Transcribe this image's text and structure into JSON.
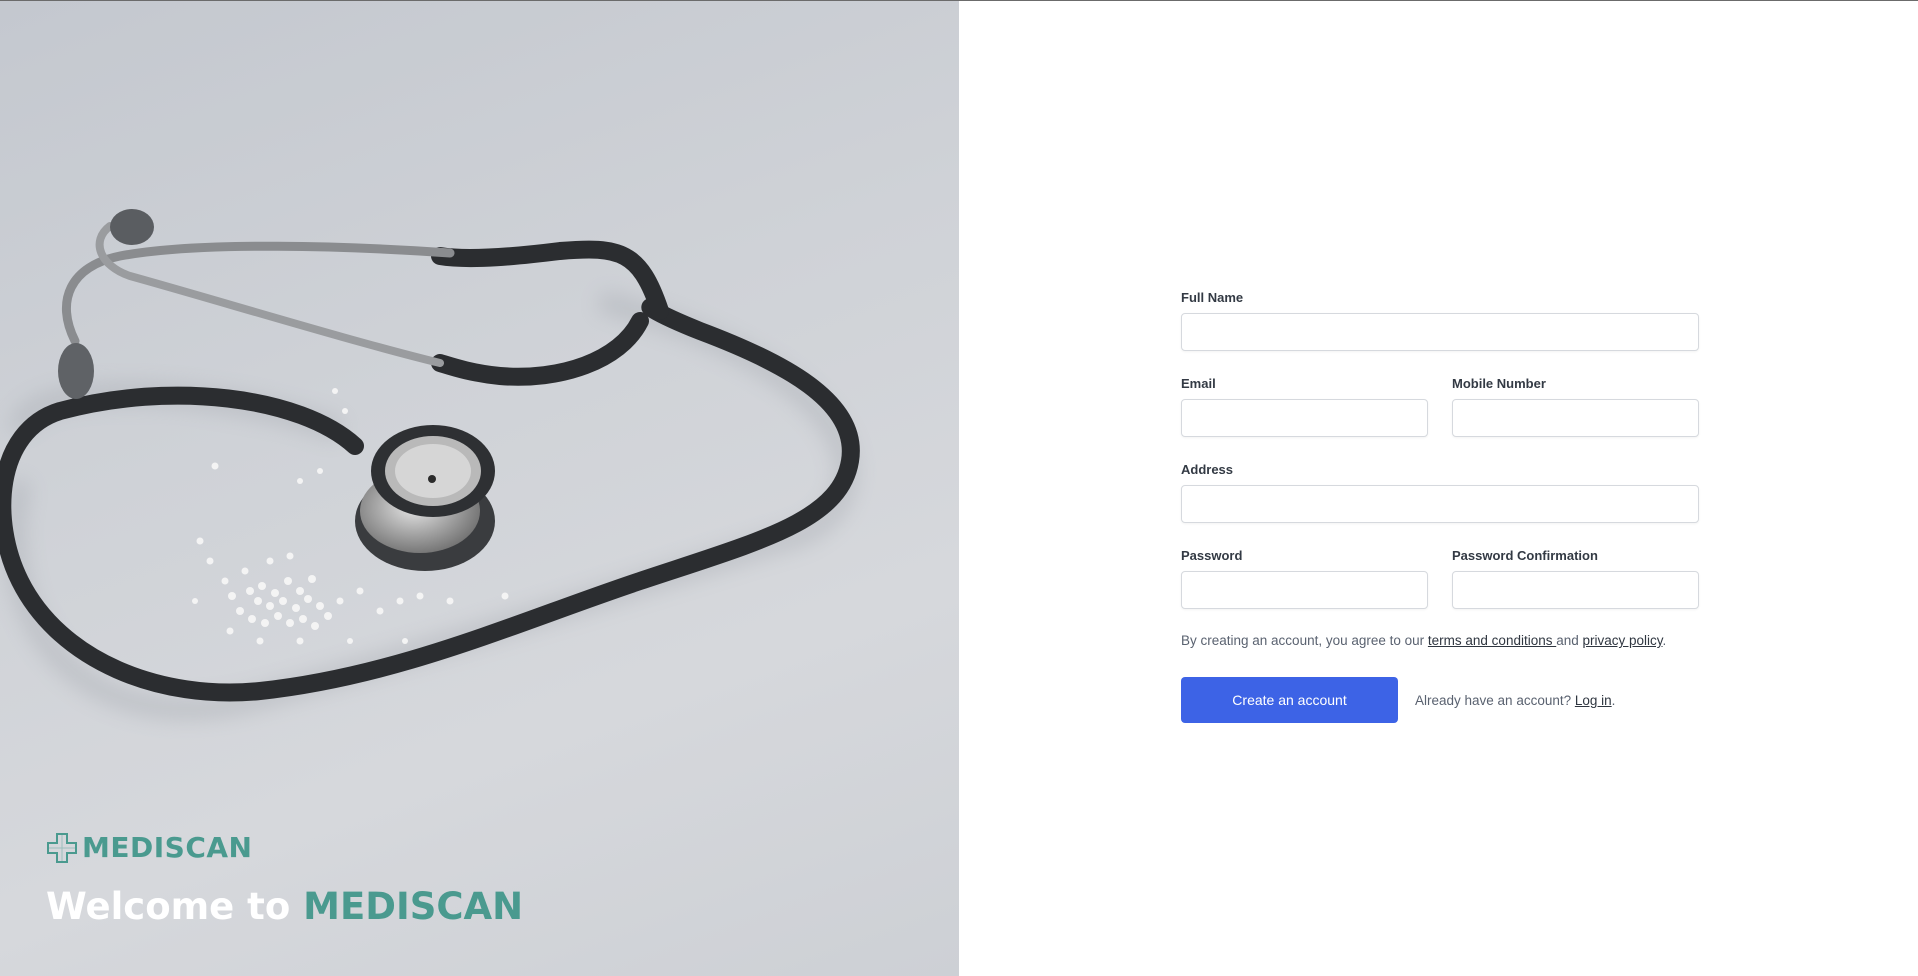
{
  "hero": {
    "brand_name": "MEDISCAN",
    "welcome_prefix": "Welcome to ",
    "welcome_brand": "MEDISCAN",
    "brand_color": "#4a9a8f",
    "logo_icon": "medical-cross-icon",
    "image_subject": "stethoscope-photo"
  },
  "form": {
    "full_name_label": "Full Name",
    "full_name_value": "",
    "email_label": "Email",
    "email_value": "",
    "mobile_label": "Mobile Number",
    "mobile_value": "",
    "address_label": "Address",
    "address_value": "",
    "password_label": "Password",
    "password_value": "",
    "password_confirm_label": "Password Confirmation",
    "password_confirm_value": "",
    "terms_prefix": "By creating an account, you agree to our ",
    "terms_link": "terms and conditions ",
    "terms_middle": "and ",
    "privacy_link": "privacy policy",
    "terms_suffix": ".",
    "submit_label": "Create an account",
    "login_prompt": "Already have an account? ",
    "login_link": "Log in",
    "login_suffix": ".",
    "accent_color": "#3d63e6"
  }
}
